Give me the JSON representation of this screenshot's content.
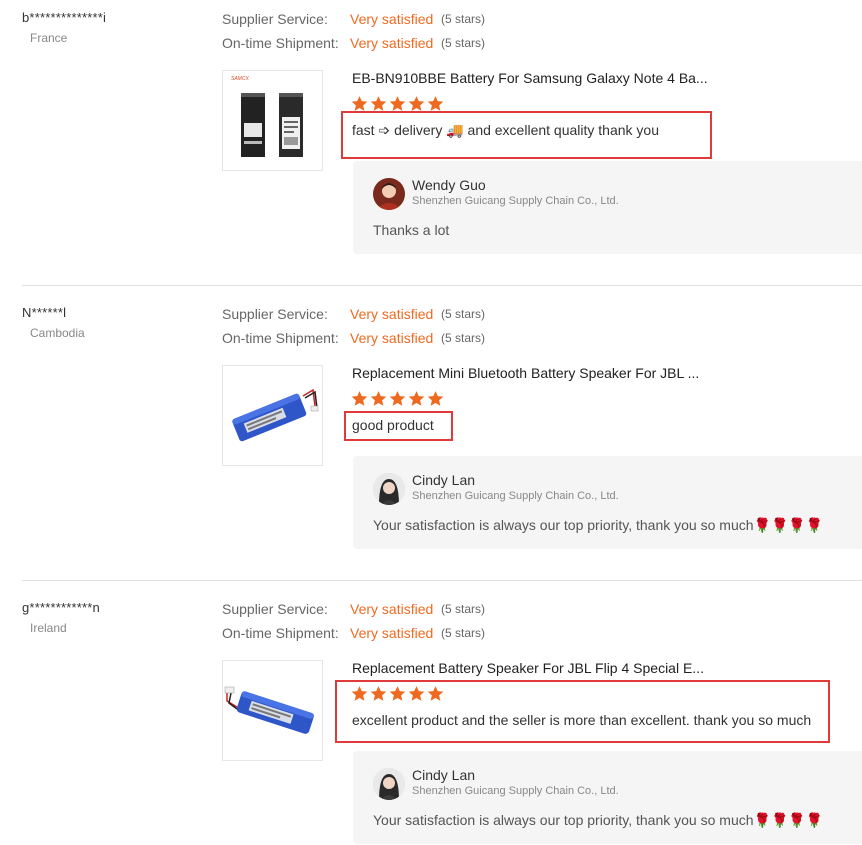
{
  "colors": {
    "accent": "#ef6a21",
    "highlight_box": "#e03a3a",
    "reply_bg": "#f5f5f5"
  },
  "labels": {
    "supplier_service": "Supplier Service:",
    "ontime_shipment": "On-time Shipment:"
  },
  "reviews": [
    {
      "buyer": "b**************i",
      "country": "France",
      "supplier_service": {
        "value": "Very satisfied",
        "stars": "(5 stars)"
      },
      "ontime_shipment": {
        "value": "Very satisfied",
        "stars": "(5 stars)"
      },
      "product_title": "EB-BN910BBE Battery For Samsung Galaxy Note 4 Ba...",
      "rating": 5,
      "text": "fast ➩ delivery 🚚 and excellent quality thank you",
      "reply": {
        "name": "Wendy Guo",
        "company": "Shenzhen Guicang Supply Chain Co., Ltd.",
        "text": "Thanks a lot"
      }
    },
    {
      "buyer": "N******l",
      "country": "Cambodia",
      "supplier_service": {
        "value": "Very satisfied",
        "stars": "(5 stars)"
      },
      "ontime_shipment": {
        "value": "Very satisfied",
        "stars": "(5 stars)"
      },
      "product_title": "Replacement Mini Bluetooth Battery Speaker For JBL ...",
      "rating": 5,
      "text": "good product",
      "reply": {
        "name": "Cindy Lan",
        "company": "Shenzhen Guicang Supply Chain Co., Ltd.",
        "text": "Your satisfaction is always our top priority, thank you so much🌹🌹🌹🌹"
      }
    },
    {
      "buyer": "g************n",
      "country": "Ireland",
      "supplier_service": {
        "value": "Very satisfied",
        "stars": "(5 stars)"
      },
      "ontime_shipment": {
        "value": "Very satisfied",
        "stars": "(5 stars)"
      },
      "product_title": "Replacement Battery Speaker For JBL Flip 4 Special E...",
      "rating": 5,
      "text": "excellent product and the seller is more than excellent. thank you so much",
      "reply": {
        "name": "Cindy Lan",
        "company": "Shenzhen Guicang Supply Chain Co., Ltd.",
        "text": "Your satisfaction is always our top priority, thank you so much🌹🌹🌹🌹"
      }
    }
  ]
}
